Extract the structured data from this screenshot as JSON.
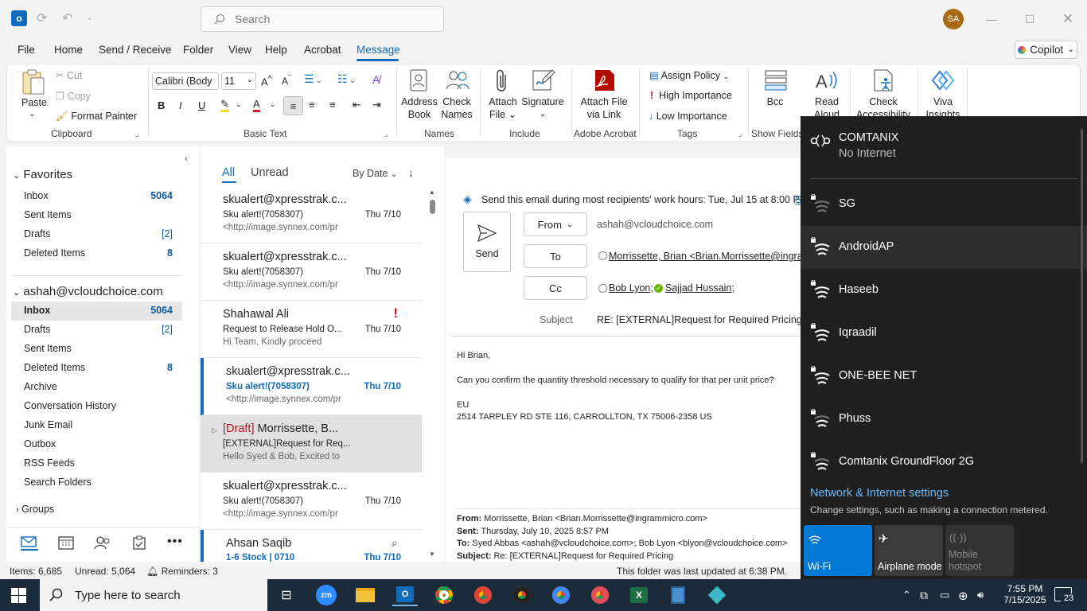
{
  "titlebar": {
    "search_placeholder": "Search",
    "avatar_initials": "SA"
  },
  "menu": {
    "items": [
      "File",
      "Home",
      "Send / Receive",
      "Folder",
      "View",
      "Help",
      "Acrobat",
      "Message"
    ],
    "active": "Message",
    "copilot": "Copilot"
  },
  "ribbon": {
    "paste": "Paste",
    "cut": "Cut",
    "copy": "Copy",
    "format_painter": "Format Painter",
    "font": "Calibri (Body",
    "size": "11",
    "address_book": [
      "Address",
      "Book"
    ],
    "check_names": [
      "Check",
      "Names"
    ],
    "attach_file": [
      "Attach",
      "File"
    ],
    "signature": "Signature",
    "attach_link": [
      "Attach File",
      "via Link"
    ],
    "assign_policy": "Assign Policy",
    "high_importance": "High Importance",
    "low_importance": "Low Importance",
    "bcc": "Bcc",
    "read_aloud": [
      "Read",
      "Aloud"
    ],
    "check_access": [
      "Check",
      "Accessibility"
    ],
    "viva": [
      "Viva",
      "Insights"
    ],
    "groups": {
      "clipboard": "Clipboard",
      "basic_text": "Basic Text",
      "names": "Names",
      "include": "Include",
      "adobe": "Adobe Acrobat",
      "tags": "Tags",
      "show_fields": "Show Fields"
    }
  },
  "nav": {
    "favorites": "Favorites",
    "fav_items": [
      {
        "label": "Inbox",
        "count": "5064"
      },
      {
        "label": "Sent Items",
        "count": ""
      },
      {
        "label": "Drafts",
        "count": "[2]"
      },
      {
        "label": "Deleted Items",
        "count": "8"
      }
    ],
    "account": "ashah@vcloudchoice.com",
    "acct_items": [
      {
        "label": "Inbox",
        "count": "5064"
      },
      {
        "label": "Drafts",
        "count": "[2]"
      },
      {
        "label": "Sent Items",
        "count": ""
      },
      {
        "label": "Deleted Items",
        "count": "8"
      },
      {
        "label": "Archive",
        "count": ""
      },
      {
        "label": "Conversation History",
        "count": ""
      },
      {
        "label": "Junk Email",
        "count": ""
      },
      {
        "label": "Outbox",
        "count": ""
      },
      {
        "label": "RSS Feeds",
        "count": ""
      },
      {
        "label": "Search Folders",
        "count": ""
      }
    ],
    "groups": "Groups"
  },
  "list": {
    "tab_all": "All",
    "tab_unread": "Unread",
    "sort": "By Date",
    "messages": [
      {
        "sender": "skualert@xpresstrak.c...",
        "subject": "Sku alert!(7058307)",
        "preview": "<http://image.synnex.com/pr",
        "date": "Thu 7/10"
      },
      {
        "sender": "skualert@xpresstrak.c...",
        "subject": "Sku alert!(7058307)",
        "preview": "<http://image.synnex.com/pr",
        "date": "Thu 7/10"
      },
      {
        "sender": "Shahawal Ali",
        "subject": "Request to Release Hold O...",
        "preview": "Hi Team,  Kindly proceed",
        "date": "Thu 7/10",
        "flag": "!"
      },
      {
        "sender": "skualert@xpresstrak.c...",
        "subject": "Sku alert!(7058307)",
        "preview": "<http://image.synnex.com/pr",
        "date": "Thu 7/10"
      },
      {
        "draft": "[Draft]",
        "sender": "Morrissette, B...",
        "subject": "[EXTERNAL]Request for Req...",
        "preview": "Hello Syed & Bob,  Excited to",
        "date": ""
      },
      {
        "sender": "skualert@xpresstrak.c...",
        "subject": "Sku alert!(7058307)",
        "preview": "<http://image.synnex.com/pr",
        "date": "Thu 7/10"
      },
      {
        "sender": "Ahsan Saqib",
        "subject": "1-6 Stock | 0710",
        "preview": "",
        "date": "Thu 7/10"
      }
    ]
  },
  "compose": {
    "schedule_tip": "Send this email during most recipients' work hours: Tue, Jul 15 at 8:00 PM",
    "schedule_link": "S",
    "send": "Send",
    "from_label": "From",
    "from_value": "ashah@vcloudchoice.com",
    "to_label": "To",
    "to_value": "Morrissette, Brian <Brian.Morrissette@ingram",
    "cc_label": "Cc",
    "cc_1": "Bob Lyon;",
    "cc_2": "Sajjad Hussain;",
    "subject_label": "Subject",
    "subject_value": "RE: [EXTERNAL]Request for Required Pricing",
    "body": {
      "greeting": "Hi Brian,",
      "line1": "Can you confirm the quantity threshold necessary to qualify for that per unit price?",
      "sig1": "EU",
      "sig2": "2514 TARPLEY RD STE 116, CARROLLTON, TX 75006-2358 US",
      "q_from_label": "From:",
      "q_from": " Morrissette, Brian <Brian.Morrissette@ingrammicro.com>",
      "q_sent_label": "Sent:",
      "q_sent": " Thursday, July 10, 2025 8:57 PM",
      "q_to_label": "To:",
      "q_to": " Syed Abbas <ashah@vcloudchoice.com>; Bob Lyon <blyon@vcloudchoice.com>",
      "q_subj_label": "Subject:",
      "q_subj": " Re: [EXTERNAL]Request for Required Pricing"
    }
  },
  "status": {
    "items": "Items: 6,685",
    "unread": "Unread: 5,064",
    "reminders": "Reminders: 3",
    "updated": "This folder was last updated at 6:38 PM."
  },
  "wifi": {
    "connected_name": "COMTANIX",
    "connected_status": "No Internet",
    "networks": [
      "SG",
      "AndroidAP",
      "Haseeb",
      "Iqraadil",
      "ONE-BEE NET",
      "Phuss",
      "Comtanix GroundFloor 2G"
    ],
    "settings_title": "Network & Internet settings",
    "settings_sub": "Change settings, such as making a connection metered.",
    "tiles": {
      "wifi": "Wi-Fi",
      "airplane": "Airplane mode",
      "hotspot": [
        "Mobile",
        "hotspot"
      ]
    }
  },
  "taskbar": {
    "search_placeholder": "Type here to search",
    "time": "7:55 PM",
    "date": "7/15/2025",
    "notif_count": "23"
  },
  "colors": {
    "accent": "#0f6cbd",
    "flyout_bg": "#202020",
    "taskbar_bg": "#1c2b3a",
    "flag_red": "#c50f1f"
  }
}
